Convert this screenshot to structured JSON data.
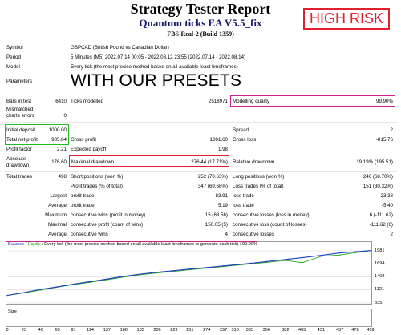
{
  "header": {
    "title": "Strategy Tester Report",
    "subtitle": "Quantum ticks EA V5.5_fix",
    "build": "FBS-Real-2 (Build 1359)",
    "risk_label": "HIGH RISK",
    "presets_label": "WITH OUR PRESETS"
  },
  "info": [
    {
      "label": "Symbol",
      "value": "GBPCAD (British Pound vs Canadian Dollar)"
    },
    {
      "label": "Period",
      "value": "5 Minutes (M5) 2022.07.14 00:05 - 2022.08.12 23:55 (2022.07.14 - 2022.08.14)"
    },
    {
      "label": "Model",
      "value": "Every tick (the most precise method based on all available least timeframes)"
    },
    {
      "label": "Parameters",
      "value": ""
    }
  ],
  "stats": {
    "bars_in_test_label": "Bars in test",
    "bars_in_test": "6410",
    "ticks_modelled_label": "Ticks modelled",
    "ticks_modelled": "2518971",
    "modelling_quality_label": "Modelling quality",
    "modelling_quality": "99.90%",
    "mismatched_label_1": "Mismatched",
    "mismatched_label_2": "charts errors",
    "mismatched": "0",
    "initial_deposit_label": "Initial deposit",
    "initial_deposit": "1000.00",
    "spread_label": "Spread",
    "spread": "2",
    "total_net_profit_label": "Total net profit",
    "total_net_profit": "985.84",
    "gross_profit_label": "Gross profit",
    "gross_profit": "1801.60",
    "gross_loss_label": "Gross loss",
    "gross_loss": "-815.76",
    "profit_factor_label": "Profit factor",
    "profit_factor": "2.21",
    "expected_payoff_label": "Expected payoff",
    "expected_payoff": "1.98",
    "absolute_dd_label_1": "Absolute",
    "absolute_dd_label_2": "drawdown",
    "absolute_dd": "176.60",
    "maximal_dd_label": "Maximal drawdown",
    "maximal_dd": "276.44 (17.71%)",
    "relative_dd_label": "Relative drawdown",
    "relative_dd": "19.19% (195.51)",
    "total_trades_label": "Total trades",
    "total_trades": "498",
    "short_pos_label": "Short positions (won %)",
    "short_pos": "252 (70.63%)",
    "long_pos_label": "Long positions (won %)",
    "long_pos": "246 (68.70%)",
    "profit_trades_label": "Profit trades (% of total)",
    "profit_trades": "347 (69.68%)",
    "loss_trades_label": "Loss trades (% of total)",
    "loss_trades": "151 (30.32%)",
    "largest_label": "Largest",
    "largest_profit_label": "profit trade",
    "largest_profit": "83.91",
    "largest_loss_label": "loss trade",
    "largest_loss": "-23.38",
    "average_label": "Average",
    "average_profit_label": "profit trade",
    "average_profit": "5.19",
    "average_loss_label": "loss trade",
    "average_loss": "-5.40",
    "maximum_label": "Maximum",
    "max_cons_wins_label": "consecutive wins (profit in money)",
    "max_cons_wins": "15 (63.56)",
    "max_cons_losses_label": "consecutive losses (loss in money)",
    "max_cons_losses": "6 (-111.62)",
    "maximal_label": "Maximal",
    "maximal_cons_profit_label": "consecutive profit (count of wins)",
    "maximal_cons_profit": "150.05 (5)",
    "maximal_cons_loss_label": "consecutive loss (count of losses)",
    "maximal_cons_loss": "-111.62 (6)",
    "average2_label": "Average",
    "avg_cons_wins_label": "consecutive wins",
    "avg_cons_wins": "4",
    "avg_cons_losses_label": "consecutive losses",
    "avg_cons_losses": "2"
  },
  "chart": {
    "legend_balance": "Balance",
    "legend_sep": " / ",
    "legend_equity": "Equity",
    "legend_rest": " / Every tick (the most precise method based on all available least timeframes to generate each tick) / ",
    "legend_quality": "99.90%",
    "size_label": "Size",
    "y_ticks": [
      "1981",
      "1694",
      "1408",
      "1121",
      "835"
    ],
    "x_ticks": [
      "0",
      "23",
      "46",
      "69",
      "91",
      "114",
      "137",
      "160",
      "183",
      "206",
      "229",
      "251",
      "274",
      "297",
      "313",
      "333",
      "356",
      "382",
      "405",
      "431",
      "457",
      "478",
      "499"
    ],
    "colors": {
      "balance": "#1f3fbf",
      "equity": "#14a014",
      "grid": "#d0d0d0",
      "magenta": "#cc1f8f",
      "red": "#e0202a",
      "green": "#22bb22"
    }
  },
  "chart_data": {
    "type": "line",
    "x": [
      0,
      23,
      46,
      69,
      91,
      114,
      137,
      160,
      183,
      206,
      229,
      251,
      274,
      297,
      313,
      333,
      356,
      382,
      405,
      431,
      457,
      478,
      499
    ],
    "series": [
      {
        "name": "Balance",
        "values": [
          1000,
          1065,
          1135,
          1190,
          1250,
          1305,
          1360,
          1420,
          1470,
          1510,
          1545,
          1580,
          1615,
          1650,
          1675,
          1705,
          1745,
          1790,
          1830,
          1880,
          1935,
          1960,
          1986
        ]
      },
      {
        "name": "Equity",
        "values": [
          1000,
          1055,
          1120,
          1180,
          1238,
          1290,
          1345,
          1405,
          1455,
          1495,
          1530,
          1565,
          1600,
          1635,
          1662,
          1690,
          1725,
          1770,
          1720,
          1860,
          1890,
          1940,
          1982
        ]
      }
    ],
    "ylim": [
      835,
      1981
    ]
  }
}
